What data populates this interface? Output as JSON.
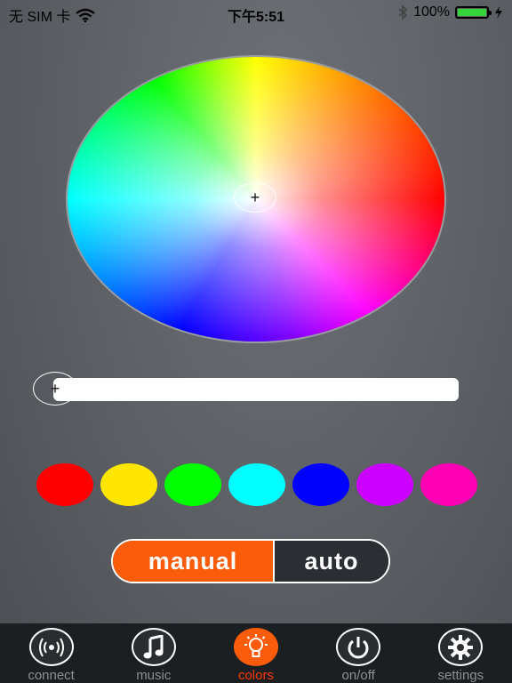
{
  "status_bar": {
    "carrier": "无 SIM 卡",
    "time": "下午5:51",
    "battery": "100%",
    "battery_level": 1.0,
    "battery_color": "#35d43b"
  },
  "color_wheel": {
    "cursor_symbol": "+"
  },
  "brightness_slider": {
    "thumb_symbol": "+",
    "value": 0.0
  },
  "swatches": [
    {
      "name": "red",
      "color": "#ff0000"
    },
    {
      "name": "yellow",
      "color": "#ffe600"
    },
    {
      "name": "green",
      "color": "#00ff00"
    },
    {
      "name": "cyan",
      "color": "#00ffff"
    },
    {
      "name": "blue",
      "color": "#0000ff"
    },
    {
      "name": "violet",
      "color": "#cc00ff"
    },
    {
      "name": "magenta",
      "color": "#ff00b4"
    }
  ],
  "mode_toggle": {
    "manual_label": "manual",
    "auto_label": "auto",
    "selected": "manual",
    "accent": "#fb5c0a"
  },
  "tabs": [
    {
      "label": "connect",
      "icon": "signal-waves-icon",
      "active": false
    },
    {
      "label": "music",
      "icon": "music-note-icon",
      "active": false
    },
    {
      "label": "colors",
      "icon": "light-bulb-icon",
      "active": true
    },
    {
      "label": "on/off",
      "icon": "power-icon",
      "active": false
    },
    {
      "label": "settings",
      "icon": "gear-icon",
      "active": false
    }
  ]
}
